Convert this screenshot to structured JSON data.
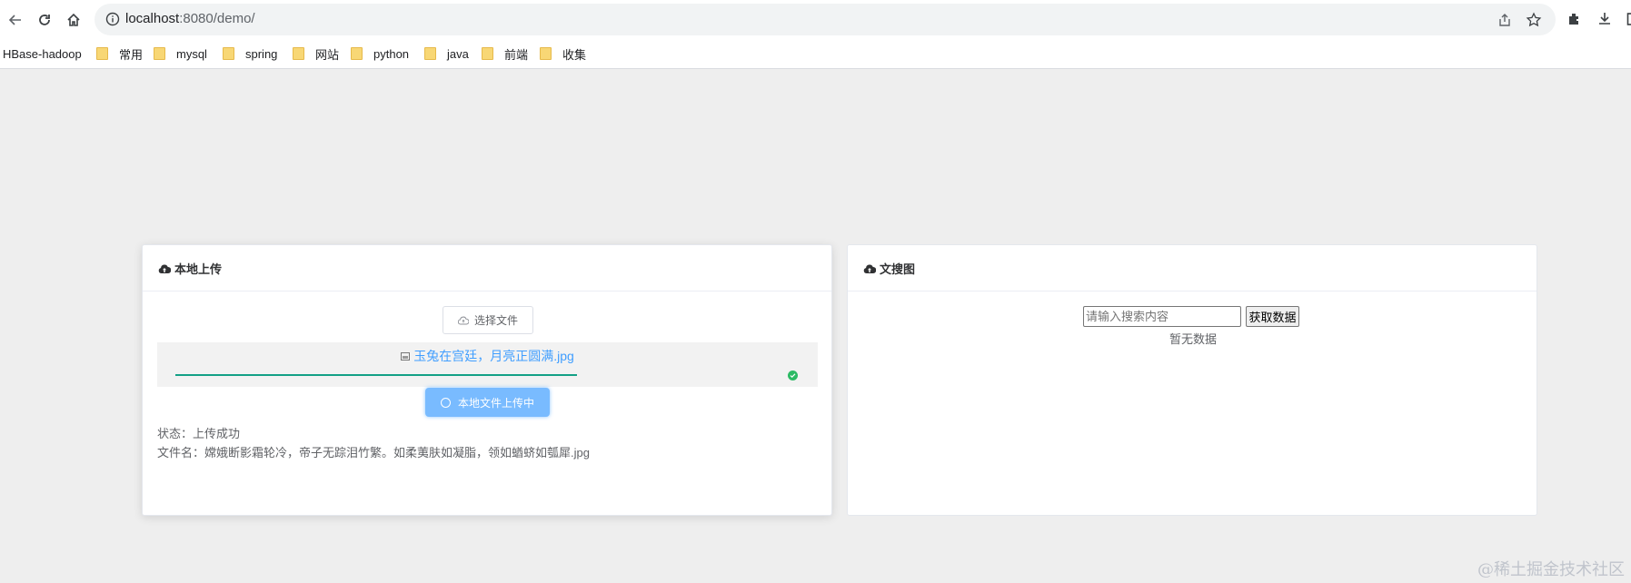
{
  "browser": {
    "url_host": "localhost",
    "url_rest": ":8080/demo/"
  },
  "bookmarks": [
    "HBase-hadoop",
    "常用",
    "mysql",
    "spring",
    "网站",
    "python",
    "java",
    "前端",
    "收集"
  ],
  "upload_card": {
    "title": "本地上传",
    "choose_label": "选择文件",
    "file_name": "玉兔在宫廷，月亮正圆满.jpg",
    "upload_button": "本地文件上传中",
    "status_line": "状态：上传成功",
    "filename_line": "文件名：嫦娥断影霜轮冷，帝子无踪泪竹繁。如柔荑肤如凝脂，领如蝤蛴如瓠犀.jpg",
    "progress": 1.0
  },
  "search_card": {
    "title": "文搜图",
    "search_placeholder": "请输入搜索内容",
    "fetch_button": "获取数据",
    "empty_text": "暂无数据"
  },
  "watermark": "@稀土掘金技术社区",
  "colors": {
    "page_bg": "#eeeeee",
    "link": "#409eff",
    "progress": "#13a086",
    "success": "#2cba64",
    "button_loading": "#79bbff"
  }
}
